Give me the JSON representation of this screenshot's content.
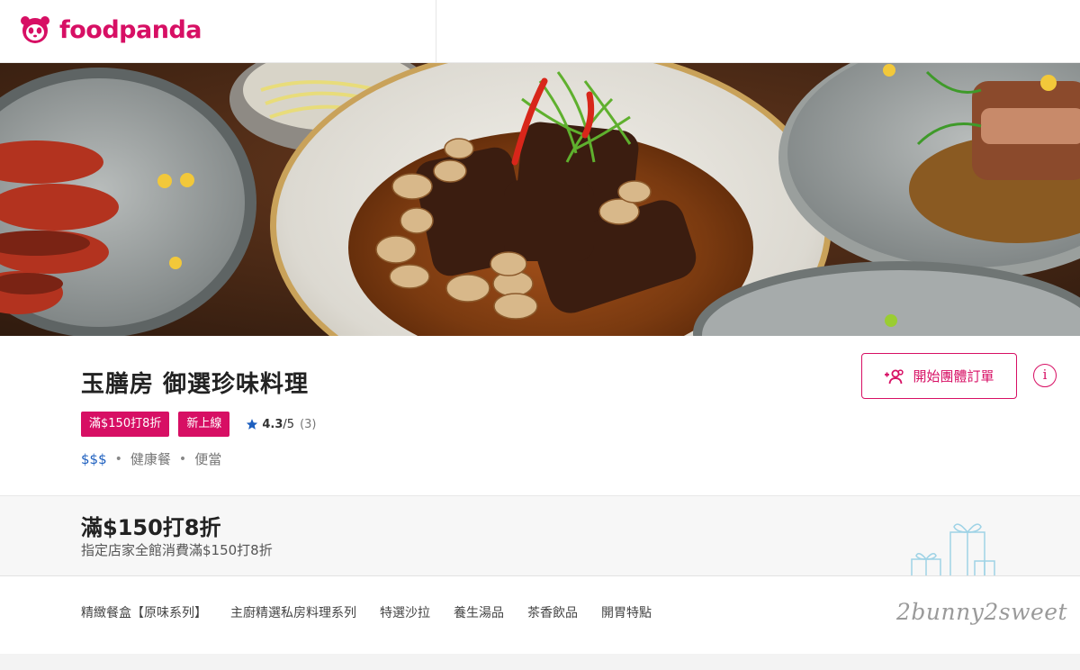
{
  "header": {
    "logo_text": "foodpanda",
    "brand_color": "#d70f64"
  },
  "hero": {
    "image_icon": "food-photo"
  },
  "vendor": {
    "name": "玉膳房 御選珍味料理",
    "tags": [
      "滿$150打8折",
      "新上線"
    ],
    "rating": {
      "score": "4.3",
      "out_of": "/5",
      "count": "(3)",
      "star_color": "#1d5fbf"
    },
    "price_level": "$$$",
    "cuisines": [
      "健康餐",
      "便當"
    ],
    "separator": "•",
    "group_order_label": "開始團體訂單",
    "info_icon_label": "i"
  },
  "promo": {
    "title": "滿$150打8折",
    "subtitle": "指定店家全館消費滿$150打8折"
  },
  "menu": {
    "tabs": [
      "精緻餐盒【原味系列】",
      "主廚精選私房料理系列",
      "特選沙拉",
      "養生湯品",
      "茶香飲品",
      "開胃特點"
    ]
  },
  "watermark": "2bunny2sweet"
}
